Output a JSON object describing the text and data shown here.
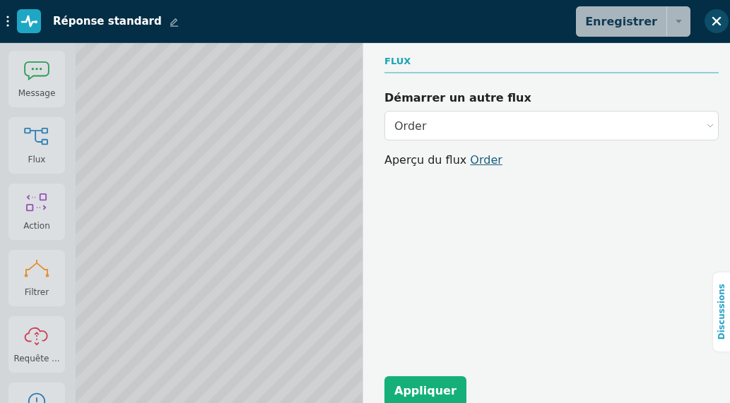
{
  "header": {
    "title": "Réponse standard",
    "save_button": "Enregistrer"
  },
  "sidebar": {
    "items": [
      {
        "kind": "message",
        "label": "Message"
      },
      {
        "kind": "flow",
        "label": "Flux"
      },
      {
        "kind": "action",
        "label": "Action"
      },
      {
        "kind": "filter",
        "label": "Filtrer"
      },
      {
        "kind": "request",
        "label": "Requête ..."
      },
      {
        "kind": "timer"
      }
    ]
  },
  "panel": {
    "section": "FLUX",
    "field_label": "Démarrer un autre flux",
    "select_value": "Order",
    "preview_text": "Aperçu du flux",
    "preview_link": "Order",
    "apply_button": "Appliquer"
  },
  "side_tab": "Discussions"
}
